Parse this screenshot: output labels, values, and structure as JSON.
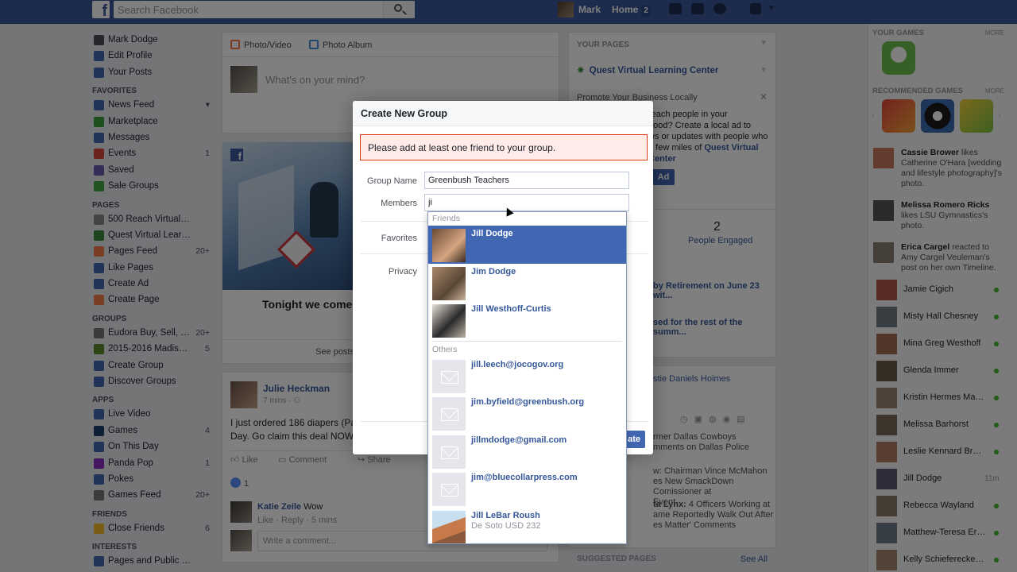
{
  "topbar": {
    "logo": "f",
    "search_placeholder": "Search Facebook",
    "user_name": "Mark",
    "home_label": "Home",
    "home_count": "2"
  },
  "leftnav": {
    "profile": [
      {
        "label": "Mark Dodge"
      },
      {
        "label": "Edit Profile"
      },
      {
        "label": "Your Posts"
      }
    ],
    "sections": [
      {
        "title": "FAVORITES",
        "items": [
          {
            "label": "News Feed",
            "count": "▾"
          },
          {
            "label": "Marketplace",
            "count": ""
          },
          {
            "label": "Messages",
            "count": ""
          },
          {
            "label": "Events",
            "count": "1"
          },
          {
            "label": "Saved",
            "count": ""
          },
          {
            "label": "Sale Groups",
            "count": ""
          }
        ]
      },
      {
        "title": "PAGES",
        "items": [
          {
            "label": "500 Reach Virtual L...",
            "count": ""
          },
          {
            "label": "Quest Virtual Learni...",
            "count": ""
          },
          {
            "label": "Pages Feed",
            "count": "20+"
          },
          {
            "label": "Like Pages",
            "count": ""
          },
          {
            "label": "Create Ad",
            "count": ""
          },
          {
            "label": "Create Page",
            "count": ""
          }
        ]
      },
      {
        "title": "GROUPS",
        "items": [
          {
            "label": "Eudora Buy, Sell, & T...",
            "count": "20+"
          },
          {
            "label": "2015-2016 Madison ...",
            "count": "5"
          },
          {
            "label": "Create Group",
            "count": ""
          },
          {
            "label": "Discover Groups",
            "count": ""
          }
        ]
      },
      {
        "title": "APPS",
        "items": [
          {
            "label": "Live Video",
            "count": ""
          },
          {
            "label": "Games",
            "count": "4"
          },
          {
            "label": "On This Day",
            "count": ""
          },
          {
            "label": "Panda Pop",
            "count": "1"
          },
          {
            "label": "Pokes",
            "count": ""
          },
          {
            "label": "Games Feed",
            "count": "20+"
          }
        ]
      },
      {
        "title": "FRIENDS",
        "items": [
          {
            "label": "Close Friends",
            "count": "6"
          }
        ]
      },
      {
        "title": "INTERESTS",
        "items": [
          {
            "label": "Pages and Public Fi...",
            "count": ""
          }
        ]
      }
    ]
  },
  "composer": {
    "photo_video": "Photo/Video",
    "photo_album": "Photo Album",
    "placeholder": "What's on your mind?"
  },
  "promo": {
    "tonight": "Tonight we come",
    "see_posts": "See posts"
  },
  "post": {
    "author": "Julie Heckman",
    "time": "7 mins · ",
    "text_line1": "I just ordered 186 diapers (Pa",
    "text_line2": "Day. Go claim this deal NOW",
    "like": "Like",
    "comment": "Comment",
    "share": "Share",
    "like_count": "1",
    "commenter": "Katie Zeile",
    "comment_text": "Wow",
    "comment_actions": "Like · Reply · 5 mins",
    "write_comment": "Write a comment..."
  },
  "your_pages": {
    "title": "YOUR PAGES",
    "page_name": "Quest Virtual Learning Center",
    "promote": "Promote Your Business Locally",
    "ad_text_1": "reach people in your",
    "ad_text_2": "hood? Create a local ad to",
    "ad_text_3": "ws or updates with people who",
    "ad_text_4": "a few miles of",
    "ad_link": "Quest Virtual",
    "ad_link_2": "Center",
    "ad_button": "Ad",
    "engaged_count": "2",
    "engaged_label": "People Engaged",
    "link_1": "by Retirement on June 23 wit...",
    "link_2": "sed for the rest of the summ...",
    "trending_1": "stie Daniels Hoimes",
    "t1": "rmer Dallas Cowboys",
    "t2": "mments on Dallas Police",
    "t3": "w: Chairman Vince McMahon",
    "t4": "es New SmackDown Comissioner at",
    "t5": "Event",
    "t6": "ta Lynx:",
    "t7": "4 Officers Working at",
    "t8": "ame Reportedly Walk Out After",
    "t9": "es Matter' Comments",
    "suggested": "SUGGESTED PAGES",
    "see_all": "See All"
  },
  "right": {
    "your_games": "YOUR GAMES",
    "more": "MORE",
    "recommended": "RECOMMENDED GAMES",
    "more2": "MORE",
    "activity": [
      {
        "name": "Cassie Brower",
        "rest": " likes Catherine O'Hara [wedding and lifestyle photography]'s photo."
      },
      {
        "name": "Melissa Romero Ricks",
        "rest": " likes LSU Gymnastics's photo."
      },
      {
        "name": "Erica Cargel",
        "rest": " reacted to Amy Cargel Veuleman's post on her own Timeline."
      }
    ],
    "chat": [
      {
        "name": "Jamie Cigich",
        "time": ""
      },
      {
        "name": "Misty Hall Chesney",
        "time": ""
      },
      {
        "name": "Mina Greg Westhoff",
        "time": ""
      },
      {
        "name": "Glenda Immer",
        "time": ""
      },
      {
        "name": "Kristin Hermes Mage...",
        "time": ""
      },
      {
        "name": "Melissa Barhorst",
        "time": ""
      },
      {
        "name": "Leslie Kennard Brock...",
        "time": ""
      },
      {
        "name": "Jill Dodge",
        "time": "11m"
      },
      {
        "name": "Rebecca Wayland",
        "time": ""
      },
      {
        "name": "Matthew-Teresa Eric...",
        "time": ""
      },
      {
        "name": "Kelly Schieferecke M...",
        "time": ""
      }
    ]
  },
  "modal": {
    "title": "Create New Group",
    "error": "Please add at least one friend to your group.",
    "group_name_label": "Group Name",
    "group_name_value": "Greenbush Teachers",
    "members_label": "Members",
    "members_value": "ji",
    "favorites_label": "Favorites",
    "privacy_label": "Privacy",
    "create_button": "ate"
  },
  "dropdown": {
    "friends_header": "Friends",
    "friends": [
      {
        "name": "Jill Dodge",
        "sub": ""
      },
      {
        "name": "Jim Dodge",
        "sub": ""
      },
      {
        "name": "Jill Westhoff-Curtis",
        "sub": ""
      }
    ],
    "others_header": "Others",
    "others": [
      {
        "name": "jill.leech@jocogov.org",
        "sub": ""
      },
      {
        "name": "jim.byfield@greenbush.org",
        "sub": ""
      },
      {
        "name": "jillmdodge@gmail.com",
        "sub": ""
      },
      {
        "name": "jim@bluecollarpress.com",
        "sub": ""
      },
      {
        "name": "Jill LeBar Roush",
        "sub": "De Soto USD 232"
      }
    ]
  },
  "colors": {
    "brand": "#3b5998",
    "link": "#365899",
    "selected": "#4267b2",
    "error_bg": "#ffebe8",
    "online": "#42b72a"
  }
}
